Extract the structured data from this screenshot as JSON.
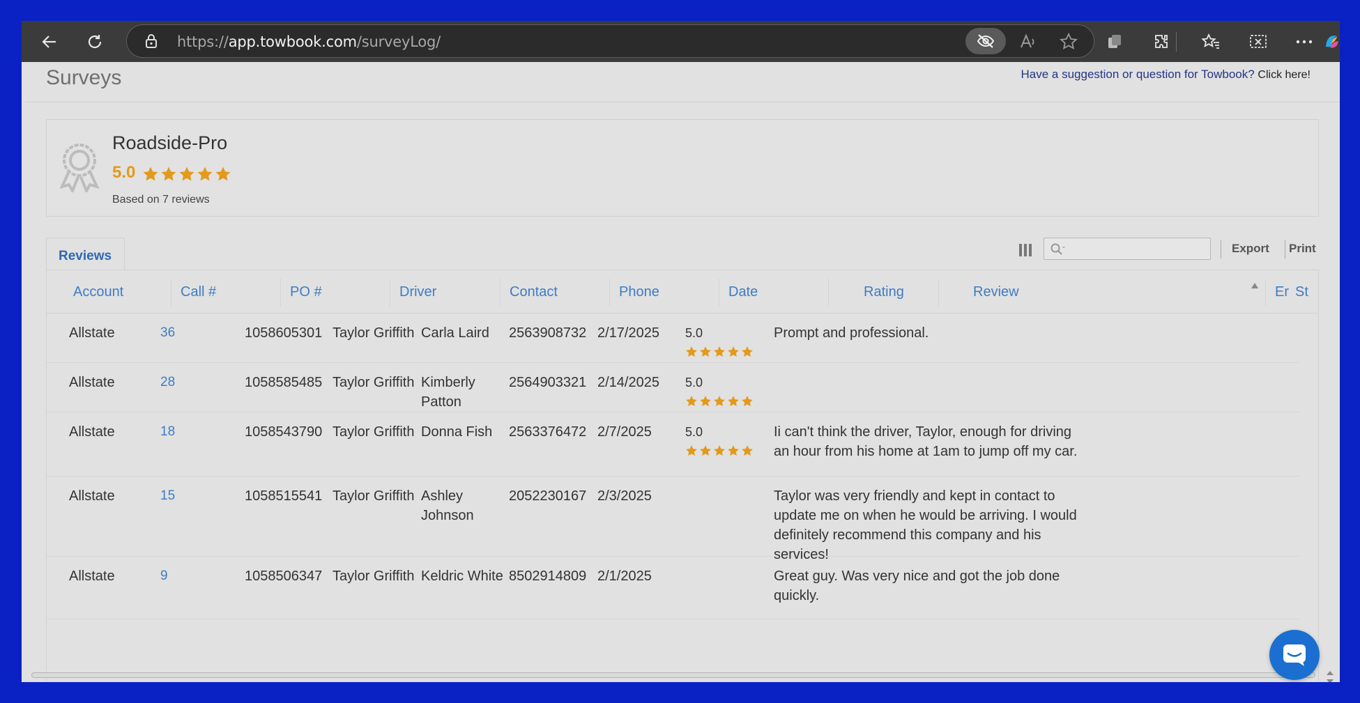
{
  "browser": {
    "url_scheme": "https://",
    "url_host": "app.towbook.com",
    "url_path": "/surveyLog/"
  },
  "page": {
    "title": "Surveys",
    "suggestion_text": "Have a suggestion or question for Towbook?",
    "suggestion_link": "Click here!"
  },
  "summary": {
    "business_name": "Roadside-Pro",
    "score": "5.0",
    "star_count": 5,
    "based_on": "Based on 7 reviews"
  },
  "reviews": {
    "tab_label": "Reviews",
    "export_label": "Export",
    "print_label": "Print",
    "columns": [
      "Account",
      "Call #",
      "PO #",
      "Driver",
      "Contact",
      "Phone",
      "Date",
      "Rating",
      "Review",
      "Er",
      "St"
    ],
    "rows": [
      {
        "account": "Allstate",
        "call": "36",
        "po": "1058605301",
        "driver": "Taylor Griffith",
        "contact": "Carla Laird",
        "phone": "2563908732",
        "date": "2/17/2025",
        "rating": "5.0",
        "review": "Prompt and professional."
      },
      {
        "account": "Allstate",
        "call": "28",
        "po": "1058585485",
        "driver": "Taylor Griffith",
        "contact": "Kimberly Patton",
        "phone": "2564903321",
        "date": "2/14/2025",
        "rating": "5.0",
        "review": ""
      },
      {
        "account": "Allstate",
        "call": "18",
        "po": "1058543790",
        "driver": "Taylor Griffith",
        "contact": "Donna Fish",
        "phone": "2563376472",
        "date": "2/7/2025",
        "rating": "5.0",
        "review": "Ii can't think the driver, Taylor, enough for driving an hour from his home at 1am to jump off my car."
      },
      {
        "account": "Allstate",
        "call": "15",
        "po": "1058515541",
        "driver": "Taylor Griffith",
        "contact": "Ashley Johnson",
        "phone": "2052230167",
        "date": "2/3/2025",
        "rating": "",
        "review": "Taylor was very friendly and kept in contact to update me on when he would be arriving. I would definitely recommend this company and his services!"
      },
      {
        "account": "Allstate",
        "call": "9",
        "po": "1058506347",
        "driver": "Taylor Griffith",
        "contact": "Keldric White",
        "phone": "8502914809",
        "date": "2/1/2025",
        "rating": "",
        "review": "Great guy. Was very nice and got the job done quickly."
      }
    ]
  },
  "colors": {
    "accent": "#3e7cc4",
    "star": "#e39a1c",
    "desktop": "#0a22c4",
    "chat": "#1a6fd0"
  }
}
